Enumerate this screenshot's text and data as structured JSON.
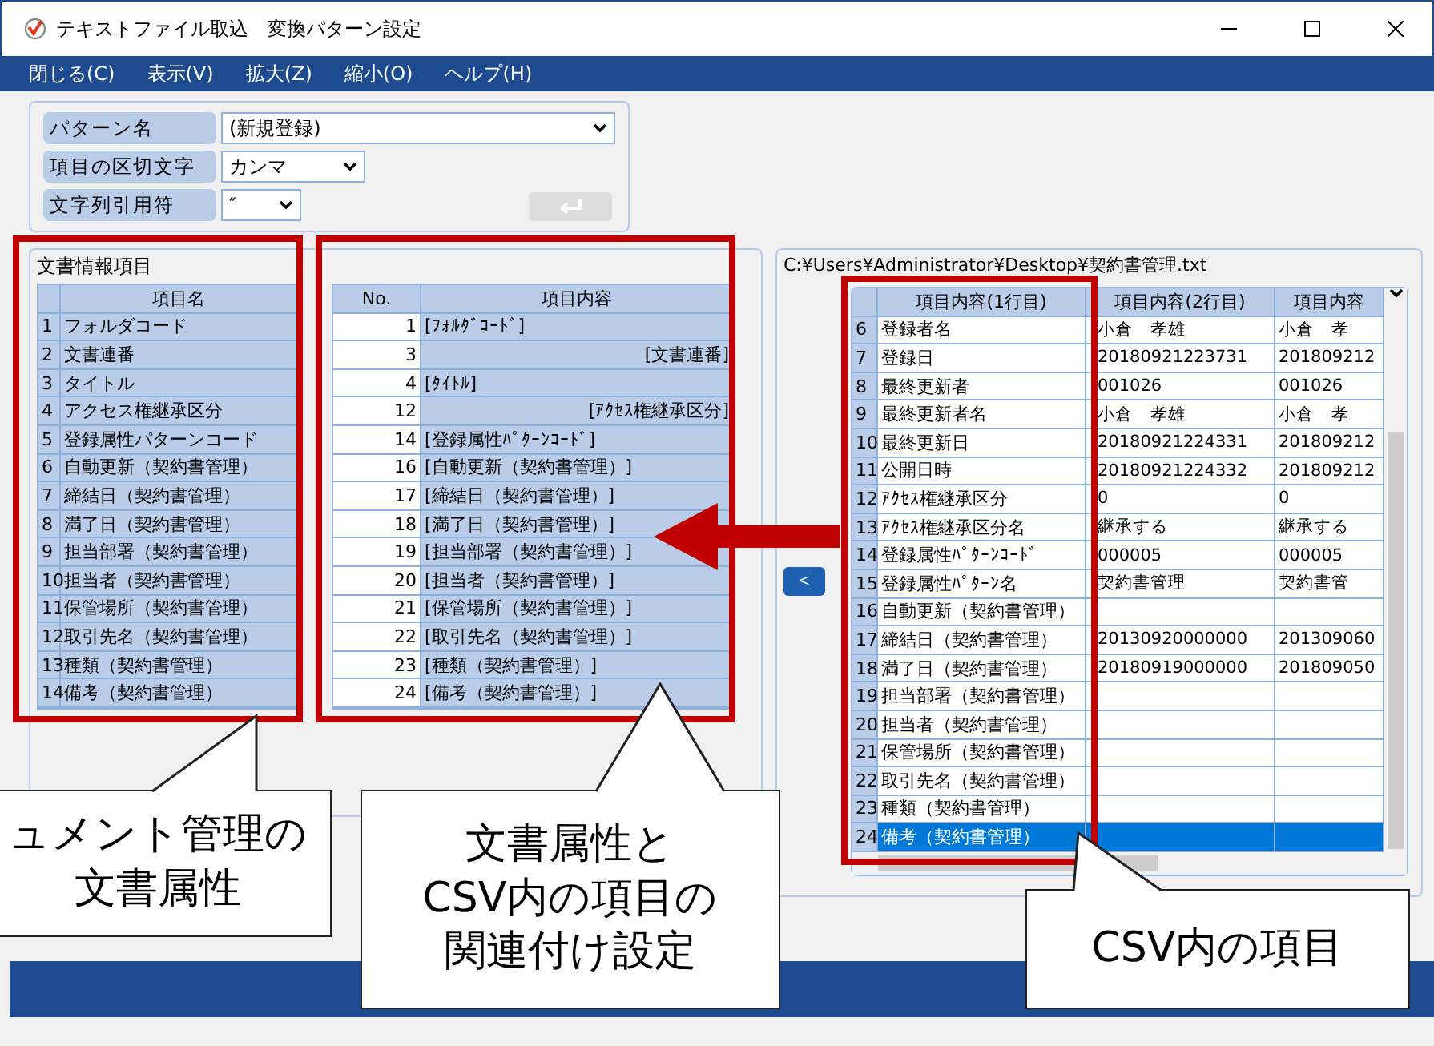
{
  "window": {
    "title": "テキストファイル取込　変換パターン設定"
  },
  "menu": [
    "閉じる(C)",
    "表示(V)",
    "拡大(Z)",
    "縮小(O)",
    "ヘルプ(H)"
  ],
  "pattern_form": {
    "fields": [
      {
        "label": "パターン名",
        "value": "(新規登録)"
      },
      {
        "label": "項目の区切文字",
        "value": "カンマ"
      },
      {
        "label": "文字列引用符",
        "value": "″"
      }
    ],
    "enter_button": {
      "disabled": true
    }
  },
  "document_items": {
    "title": "文書情報項目",
    "column": "項目名",
    "rows": [
      {
        "no": "1",
        "name": "フォルダコード"
      },
      {
        "no": "2",
        "name": "文書連番"
      },
      {
        "no": "3",
        "name": "タイトル"
      },
      {
        "no": "4",
        "name": "アクセス権継承区分"
      },
      {
        "no": "5",
        "name": "登録属性パターンコード"
      },
      {
        "no": "6",
        "name": "自動更新（契約書管理）"
      },
      {
        "no": "7",
        "name": "締結日（契約書管理）"
      },
      {
        "no": "8",
        "name": "満了日（契約書管理）"
      },
      {
        "no": "9",
        "name": "担当部署（契約書管理）"
      },
      {
        "no": "10",
        "name": "担当者（契約書管理）"
      },
      {
        "no": "11",
        "name": "保管場所（契約書管理）"
      },
      {
        "no": "12",
        "name": "取引先名（契約書管理）"
      },
      {
        "no": "13",
        "name": "種類（契約書管理）"
      },
      {
        "no": "14",
        "name": "備考（契約書管理）"
      }
    ]
  },
  "mapping": {
    "columns": [
      "No.",
      "項目内容"
    ],
    "rows": [
      {
        "no": "1",
        "content": "[ﾌｫﾙﾀﾞｺｰﾄﾞ]",
        "right_aligned": false
      },
      {
        "no": "3",
        "content": "[文書連番]",
        "right_aligned": true
      },
      {
        "no": "4",
        "content": "[ﾀｲﾄﾙ]",
        "right_aligned": false
      },
      {
        "no": "12",
        "content": "[ｱｸｾｽ権継承区分]",
        "right_aligned": true
      },
      {
        "no": "14",
        "content": "[登録属性ﾊﾟﾀｰﾝｺｰﾄﾞ]",
        "right_aligned": false
      },
      {
        "no": "16",
        "content": "[自動更新（契約書管理）]",
        "right_aligned": false
      },
      {
        "no": "17",
        "content": "[締結日（契約書管理）]",
        "right_aligned": false
      },
      {
        "no": "18",
        "content": "[満了日（契約書管理）]",
        "right_aligned": false
      },
      {
        "no": "19",
        "content": "[担当部署（契約書管理）]",
        "right_aligned": false
      },
      {
        "no": "20",
        "content": "[担当者（契約書管理）]",
        "right_aligned": false
      },
      {
        "no": "21",
        "content": "[保管場所（契約書管理）]",
        "right_aligned": false
      },
      {
        "no": "22",
        "content": "[取引先名（契約書管理）]",
        "right_aligned": false
      },
      {
        "no": "23",
        "content": "[種類（契約書管理）]",
        "right_aligned": false
      },
      {
        "no": "24",
        "content": "[備考（契約書管理）]",
        "right_aligned": false
      }
    ]
  },
  "back_button": "<",
  "csv": {
    "path": "C:¥Users¥Administrator¥Desktop¥契約書管理.txt",
    "columns": [
      "項目内容(1行目)",
      "項目内容(2行目)",
      "項目内容"
    ],
    "rows": [
      {
        "no": "6",
        "cells": [
          "登録者名",
          "小倉　孝雄",
          "小倉　孝"
        ],
        "selected": false
      },
      {
        "no": "7",
        "cells": [
          "登録日",
          "20180921223731",
          "201809212"
        ],
        "selected": false
      },
      {
        "no": "8",
        "cells": [
          "最終更新者",
          "001026",
          "001026"
        ],
        "selected": false
      },
      {
        "no": "9",
        "cells": [
          "最終更新者名",
          "小倉　孝雄",
          "小倉　孝"
        ],
        "selected": false
      },
      {
        "no": "10",
        "cells": [
          "最終更新日",
          "20180921224331",
          "201809212"
        ],
        "selected": false
      },
      {
        "no": "11",
        "cells": [
          "公開日時",
          "20180921224332",
          "201809212"
        ],
        "selected": false
      },
      {
        "no": "12",
        "cells": [
          "ｱｸｾｽ権継承区分",
          "0",
          "0"
        ],
        "selected": false
      },
      {
        "no": "13",
        "cells": [
          "ｱｸｾｽ権継承区分名",
          "継承する",
          "継承する"
        ],
        "selected": false
      },
      {
        "no": "14",
        "cells": [
          "登録属性ﾊﾟﾀｰﾝｺｰﾄﾞ",
          "000005",
          "000005"
        ],
        "selected": false
      },
      {
        "no": "15",
        "cells": [
          "登録属性ﾊﾟﾀｰﾝ名",
          "契約書管理",
          "契約書管"
        ],
        "selected": false
      },
      {
        "no": "16",
        "cells": [
          "自動更新（契約書管理）",
          "",
          ""
        ],
        "selected": false
      },
      {
        "no": "17",
        "cells": [
          "締結日（契約書管理）",
          "20130920000000",
          "201309060"
        ],
        "selected": false
      },
      {
        "no": "18",
        "cells": [
          "満了日（契約書管理）",
          "20180919000000",
          "201809050"
        ],
        "selected": false
      },
      {
        "no": "19",
        "cells": [
          "担当部署（契約書管理）",
          "",
          ""
        ],
        "selected": false
      },
      {
        "no": "20",
        "cells": [
          "担当者（契約書管理）",
          "",
          ""
        ],
        "selected": false
      },
      {
        "no": "21",
        "cells": [
          "保管場所（契約書管理）",
          "",
          ""
        ],
        "selected": false
      },
      {
        "no": "22",
        "cells": [
          "取引先名（契約書管理）",
          "",
          ""
        ],
        "selected": false
      },
      {
        "no": "23",
        "cells": [
          "種類（契約書管理）",
          "",
          ""
        ],
        "selected": false
      },
      {
        "no": "24",
        "cells": [
          "備考（契約書管理）",
          "",
          ""
        ],
        "selected": true
      }
    ]
  },
  "callouts": [
    {
      "lines": [
        "ュメント管理の",
        "文書属性"
      ]
    },
    {
      "lines": [
        "文書属性と",
        "CSV内の項目の",
        "関連付け設定"
      ]
    },
    {
      "lines": [
        "CSV内の項目"
      ]
    }
  ]
}
